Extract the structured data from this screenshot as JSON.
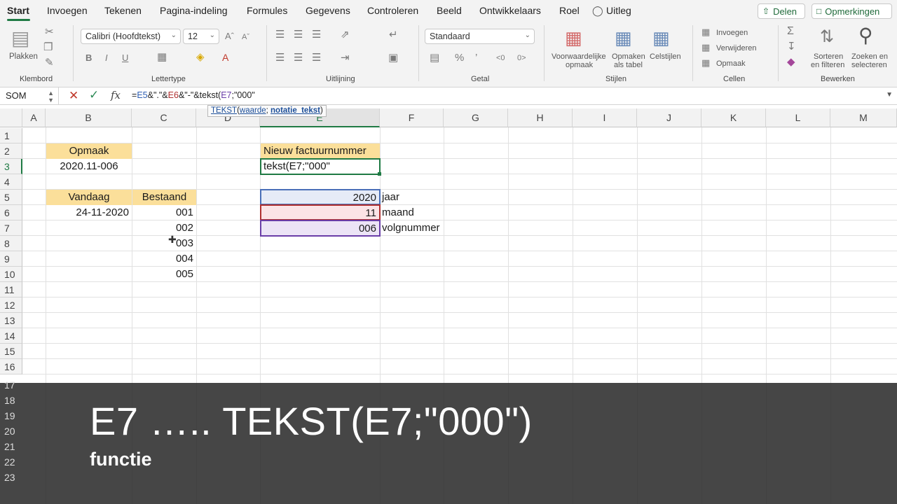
{
  "tabs": [
    "Start",
    "Invoegen",
    "Tekenen",
    "Pagina-indeling",
    "Formules",
    "Gegevens",
    "Controleren",
    "Beeld",
    "Ontwikkelaars",
    "Roel",
    "Uitleg"
  ],
  "share_label": "Delen",
  "comments_label": "Opmerkingen",
  "ribbon": {
    "paste_label": "Plakken",
    "font_name": "Calibri (Hoofdtekst)",
    "font_size": "12",
    "number_format": "Standaard",
    "cond_format_label1": "Voorwaardelijke",
    "cond_format_label2": "opmaak",
    "table_format_label1": "Opmaken",
    "table_format_label2": "als tabel",
    "cell_styles_label": "Celstijlen",
    "insert_label": "Invoegen",
    "delete_label": "Verwijderen",
    "format_label": "Opmaak",
    "sort_label1": "Sorteren",
    "sort_label2": "en filteren",
    "find_label1": "Zoeken en",
    "find_label2": "selecteren",
    "groups": [
      "Klembord",
      "Lettertype",
      "Uitlijning",
      "Getal",
      "Stijlen",
      "Cellen",
      "Bewerken"
    ]
  },
  "formula_bar": {
    "name_box": "SOM",
    "formula_parts": [
      "=",
      "E5",
      "&\".\"&",
      "E6",
      "&\"-\"&tekst(",
      "E7",
      ";\"000\""
    ],
    "tooltip_fn": "TEKST",
    "tooltip_arg1": "waarde",
    "tooltip_arg2": "notatie_tekst"
  },
  "columns": [
    "A",
    "B",
    "C",
    "D",
    "E",
    "F",
    "G",
    "H",
    "I",
    "J",
    "K",
    "L",
    "M"
  ],
  "rows": [
    "1",
    "2",
    "3",
    "4",
    "5",
    "6",
    "7",
    "8",
    "9",
    "10",
    "11",
    "12",
    "13",
    "14",
    "15",
    "16"
  ],
  "cells": {
    "B2": "Opmaak",
    "B3": "2020.11-006",
    "B5": "Vandaag",
    "C5": "Bestaand",
    "B6": "24-11-2020",
    "C6": "001",
    "C7": "002",
    "C8": "003",
    "C9": "004",
    "C10": "005",
    "E2": "Nieuw factuurnummer",
    "E3": "tekst(E7;\"000\"",
    "E5": "2020",
    "E6": "11",
    "E7": "006",
    "F5": "jaar",
    "F6": "maand",
    "F7": "volgnummer"
  },
  "overlay": {
    "title": "E7 ….. TEKST(E7;\"000\")",
    "subtitle": "functie",
    "rows": [
      "17",
      "18",
      "19",
      "20",
      "21",
      "22",
      "23"
    ]
  },
  "colors": {
    "accent": "#1f7a44",
    "header_fill": "#fbdf9a",
    "ref_blue": "#2f5fb3",
    "ref_red": "#b03030",
    "ref_purple": "#6a3ea8"
  }
}
